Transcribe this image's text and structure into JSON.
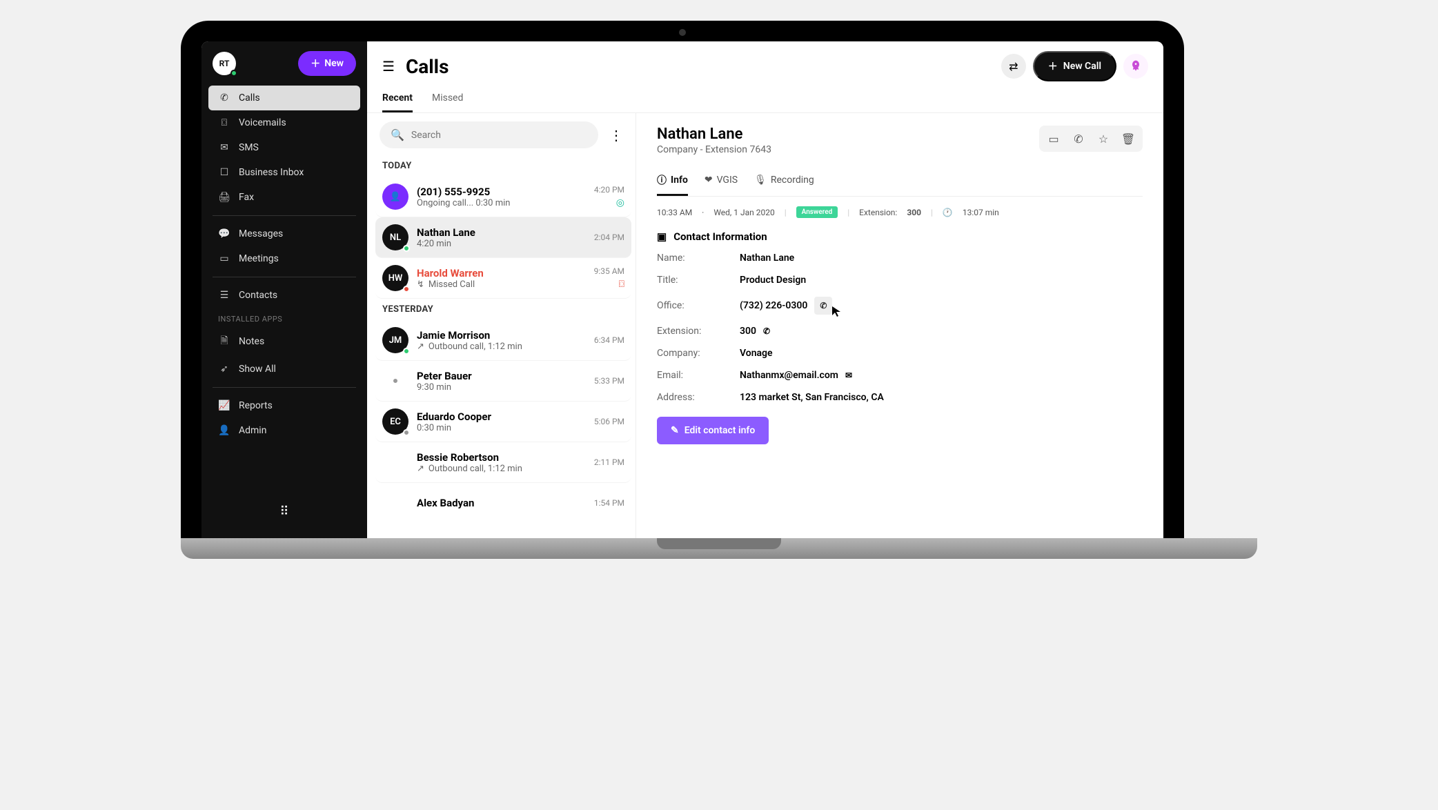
{
  "user": {
    "initials": "RT"
  },
  "header": {
    "new_button": "New",
    "page_title": "Calls",
    "new_call_button": "New Call"
  },
  "sidebar": {
    "items": [
      {
        "label": "Calls"
      },
      {
        "label": "Voicemails"
      },
      {
        "label": "SMS"
      },
      {
        "label": "Business Inbox"
      },
      {
        "label": "Fax"
      }
    ],
    "items2": [
      {
        "label": "Messages"
      },
      {
        "label": "Meetings"
      }
    ],
    "items3": [
      {
        "label": "Contacts"
      }
    ],
    "installed_label": "INSTALLED APPS",
    "items4": [
      {
        "label": "Notes"
      },
      {
        "label": "Show All"
      }
    ],
    "items5": [
      {
        "label": "Reports"
      },
      {
        "label": "Admin"
      }
    ]
  },
  "tabs": {
    "recent": "Recent",
    "missed": "Missed"
  },
  "search": {
    "placeholder": "Search"
  },
  "groups": {
    "today_label": "TODAY",
    "yesterday_label": "YESTERDAY",
    "today": [
      {
        "name": "(201) 555-9925",
        "sub": "Ongoing call... 0:30 min",
        "time": "4:20 PM"
      },
      {
        "name": "Nathan Lane",
        "initials": "NL",
        "sub": "4:20 min",
        "time": "2:04 PM"
      },
      {
        "name": "Harold Warren",
        "initials": "HW",
        "sub": "Missed Call",
        "time": "9:35 AM"
      }
    ],
    "yesterday": [
      {
        "name": "Jamie Morrison",
        "initials": "JM",
        "sub": "Outbound call, 1:12 min",
        "time": "6:34 PM"
      },
      {
        "name": "Peter Bauer",
        "sub": "9:30 min",
        "time": "5:33 PM"
      },
      {
        "name": "Eduardo Cooper",
        "initials": "EC",
        "sub": "0:30 min",
        "time": "5:06 PM"
      },
      {
        "name": "Bessie Robertson",
        "sub": "Outbound call, 1:12 min",
        "time": "2:11 PM"
      },
      {
        "name": "Alex Badyan",
        "time": "1:54 PM"
      }
    ]
  },
  "detail": {
    "name": "Nathan Lane",
    "subtitle": "Company -  Extension 7643",
    "tabs": {
      "info": "Info",
      "vgis": "VGIS",
      "recording": "Recording"
    },
    "meta": {
      "time": "10:33 AM",
      "date": "Wed, 1 Jan 2020",
      "status": "Answered",
      "extension_label": "Extension:",
      "extension_value": "300",
      "duration": "13:07 min"
    },
    "section_title": "Contact Information",
    "fields": {
      "name_label": "Name:",
      "name_value": "Nathan Lane",
      "title_label": "Title:",
      "title_value": "Product  Design",
      "office_label": "Office:",
      "office_value": "(732) 226-0300",
      "ext_label": "Extension:",
      "ext_value": "300",
      "company_label": "Company:",
      "company_value": "Vonage",
      "email_label": "Email:",
      "email_value": "Nathanmx@email.com",
      "address_label": "Address:",
      "address_value": "123 market St, San Francisco, CA"
    },
    "edit_button": "Edit contact info"
  }
}
